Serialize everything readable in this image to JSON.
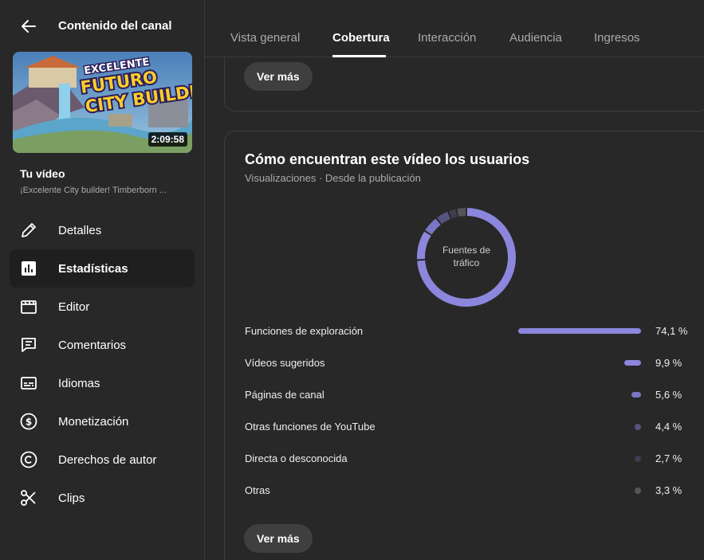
{
  "sidebar": {
    "title": "Contenido del canal",
    "back_icon": "arrow-back-icon",
    "thumbnail": {
      "overlay_lines": [
        "EXCELENTE",
        "FUTURO",
        "CITY BUILDER"
      ],
      "duration": "2:09:58"
    },
    "your_video_label": "Tu vídeo",
    "video_title": "¡Excelente City builder! Timberborn ...",
    "items": [
      {
        "label": "Detalles",
        "icon": "pencil-icon",
        "active": false
      },
      {
        "label": "Estadísticas",
        "icon": "analytics-icon",
        "active": true
      },
      {
        "label": "Editor",
        "icon": "clapperboard-icon",
        "active": false
      },
      {
        "label": "Comentarios",
        "icon": "comment-icon",
        "active": false
      },
      {
        "label": "Idiomas",
        "icon": "subtitles-icon",
        "active": false
      },
      {
        "label": "Monetización",
        "icon": "dollar-icon",
        "active": false
      },
      {
        "label": "Derechos de autor",
        "icon": "copyright-icon",
        "active": false
      },
      {
        "label": "Clips",
        "icon": "scissors-icon",
        "active": false
      }
    ]
  },
  "tabs": [
    {
      "label": "Vista general",
      "active": false
    },
    {
      "label": "Cobertura",
      "active": true
    },
    {
      "label": "Interacción",
      "active": false
    },
    {
      "label": "Audiencia",
      "active": false
    },
    {
      "label": "Ingresos",
      "active": false
    }
  ],
  "top_card": {
    "ver_mas": "Ver más"
  },
  "traffic_card": {
    "title": "Cómo encuentran este vídeo los usuarios",
    "subtitle": "Visualizaciones · Desde la publicación",
    "donut_center_label": "Fuentes de tráfico",
    "ver_mas": "Ver más"
  },
  "colors": {
    "accent": "#8c86dc",
    "series": [
      "#8c86dc",
      "#8c86dc",
      "#7a76c4",
      "#55547e",
      "#3e3d52",
      "#555555"
    ]
  },
  "chart_data": {
    "type": "pie",
    "title": "Cómo encuentran este vídeo los usuarios",
    "categories": [
      "Funciones de exploración",
      "Vídeos sugeridos",
      "Páginas de canal",
      "Otras funciones de YouTube",
      "Directa o desconocida",
      "Otras"
    ],
    "values": [
      74.1,
      9.9,
      5.6,
      4.4,
      2.7,
      3.3
    ],
    "value_labels": [
      "74,1 %",
      "9,9 %",
      "5,6 %",
      "4,4 %",
      "2,7 %",
      "3,3 %"
    ]
  }
}
